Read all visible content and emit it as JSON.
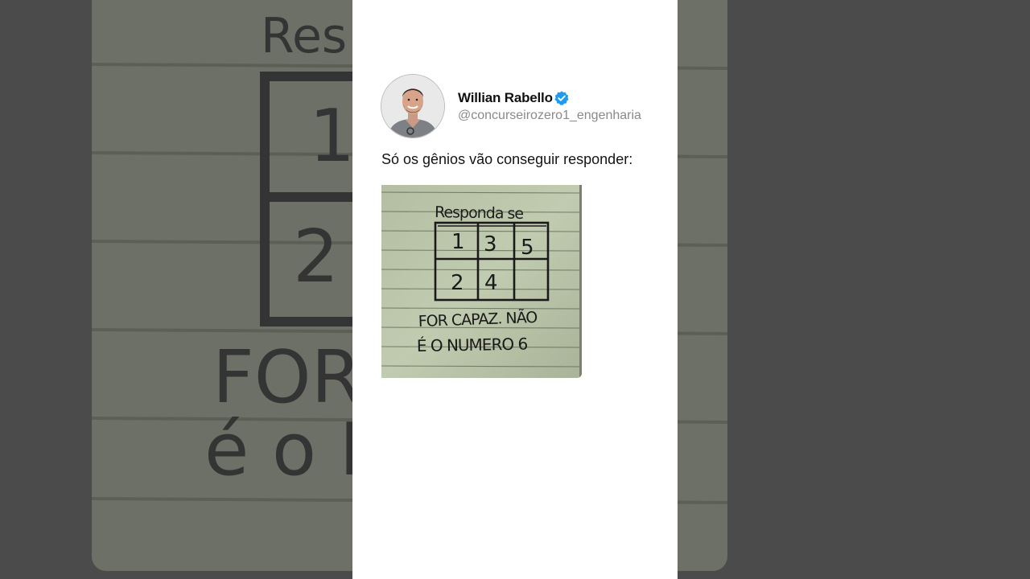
{
  "post": {
    "author_name": "Willian Rabello",
    "author_handle": "@concurseirozero1_engenharia",
    "verified": true,
    "text": "Só os gênios vão conseguir responder:"
  },
  "image": {
    "top_text": "Responda se",
    "grid": [
      [
        "1",
        "3",
        "5"
      ],
      [
        "2",
        "4",
        ""
      ]
    ],
    "bottom_line1": "FOR CAPAZ. NÃO",
    "bottom_line2": "É O NUMERO 6"
  },
  "colors": {
    "verified_badge": "#1d9bf0",
    "card_background": "#ffffff",
    "page_background": "#4b4b4b",
    "paper": "#b9c3a7"
  },
  "icons": {
    "verified": "verified-badge-icon"
  }
}
